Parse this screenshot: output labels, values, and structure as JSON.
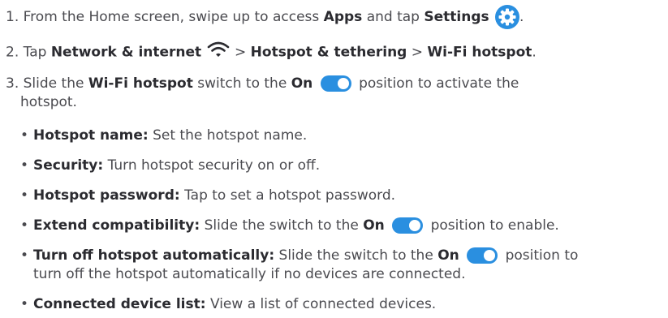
{
  "steps": [
    {
      "number": "1.",
      "pre": "From the Home screen, swipe up to access",
      "apps": "Apps",
      "mid": "and tap",
      "settings": "Settings",
      "end": "."
    },
    {
      "number": "2.",
      "pre": "Tap",
      "network": "Network & internet",
      "sep1": ">",
      "hotspot_tethering": "Hotspot & tethering",
      "sep2": ">",
      "wifi_hotspot": "Wi-Fi hotspot",
      "end": "."
    },
    {
      "number": "3.",
      "pre": "Slide the",
      "wifi_hotspot": "Wi-Fi hotspot",
      "mid": "switch to the",
      "on": "On",
      "post": "position to activate the",
      "line2": "hotspot."
    }
  ],
  "bullets": [
    {
      "term": "Hotspot name:",
      "desc": "Set the hotspot name."
    },
    {
      "term": "Security:",
      "desc": "Turn hotspot security on or off."
    },
    {
      "term": "Hotspot password:",
      "desc": "Tap to set a hotspot password."
    },
    {
      "term": "Extend compatibility:",
      "desc_pre": "Slide the switch to the",
      "on": "On",
      "desc_post": "position to enable."
    },
    {
      "term": "Turn off hotspot automatically:",
      "desc_pre": "Slide the switch to the",
      "on": "On",
      "desc_post": "position to",
      "line2": "turn off the hotspot automatically if no devices are connected."
    },
    {
      "term": "Connected device list:",
      "desc": "View a list of connected devices."
    }
  ],
  "bullet_char": "•",
  "colors": {
    "accent": "#2a8fe0",
    "text": "#4a4a4f",
    "bold_text": "#2b2b30"
  },
  "icons": {
    "settings": "gear-icon",
    "network": "wifi-icon",
    "switch": "toggle-on-icon"
  }
}
